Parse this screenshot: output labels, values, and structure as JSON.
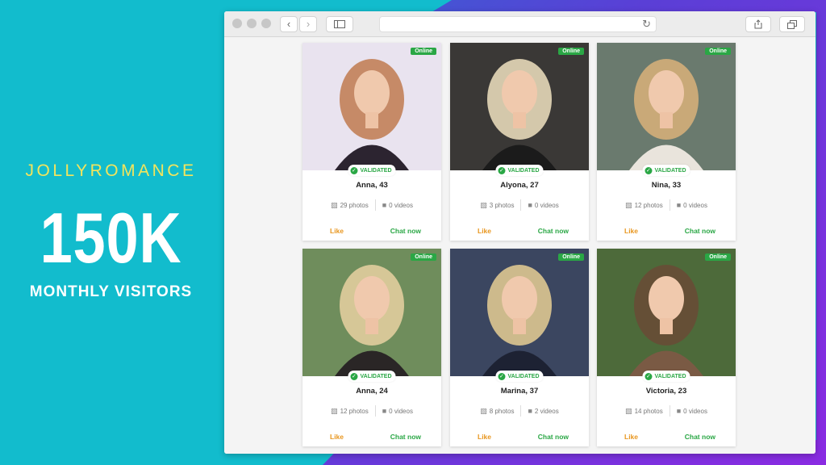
{
  "promo": {
    "brand": "JOLLYROMANCE",
    "stat": "150K",
    "stat_label": "MONTHLY VISITORS"
  },
  "browser": {
    "back_icon": "chevron-left-icon",
    "forward_icon": "chevron-right-icon",
    "sidebar_icon": "sidebar-icon",
    "reload_icon": "reload-icon",
    "share_icon": "share-icon",
    "tabs_icon": "tabs-icon"
  },
  "badges": {
    "online": "Online",
    "validated": "VALIDATED"
  },
  "actions": {
    "like": "Like",
    "chat": "Chat now"
  },
  "colors": {
    "accent_green": "#2aa745",
    "like_orange": "#e8961e",
    "brand_yellow": "#f3e45c",
    "bg_teal": "#12bccd"
  },
  "profiles": [
    {
      "name": "Anna, 43",
      "photos": "29 photos",
      "videos": "0 videos"
    },
    {
      "name": "Alyona, 27",
      "photos": "3 photos",
      "videos": "0 videos"
    },
    {
      "name": "Nina, 33",
      "photos": "12 photos",
      "videos": "0 videos"
    },
    {
      "name": "Anna, 24",
      "photos": "12 photos",
      "videos": "0 videos"
    },
    {
      "name": "Marina, 37",
      "photos": "8 photos",
      "videos": "2 videos"
    },
    {
      "name": "Victoria, 23",
      "photos": "14 photos",
      "videos": "0 videos"
    }
  ]
}
